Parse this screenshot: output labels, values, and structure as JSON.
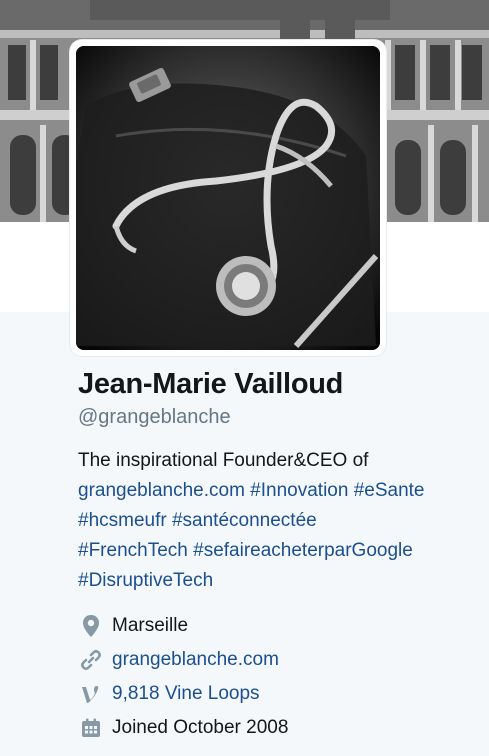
{
  "profile": {
    "name": "Jean-Marie Vailloud",
    "handle": "@grangeblanche",
    "bio_text": "The inspirational Founder&CEO of",
    "bio_links": [
      "grangeblanche.com",
      "#Innovation",
      "#eSante",
      "#hcsmeufr",
      "#santéconnectée",
      "#FrenchTech",
      "#sefaireacheterparGoogle",
      "#DisruptiveTech"
    ],
    "location": "Marseille",
    "website": "grangeblanche.com",
    "vine_loops": "9,818 Vine Loops",
    "joined": "Joined October 2008"
  },
  "icons": {
    "location": "map-pin-icon",
    "website": "link-icon",
    "vine": "vine-icon",
    "joined": "calendar-icon"
  },
  "colors": {
    "link": "#1b4f91",
    "muted": "#657786",
    "text": "#14171a",
    "background": "#f5f8fa"
  }
}
